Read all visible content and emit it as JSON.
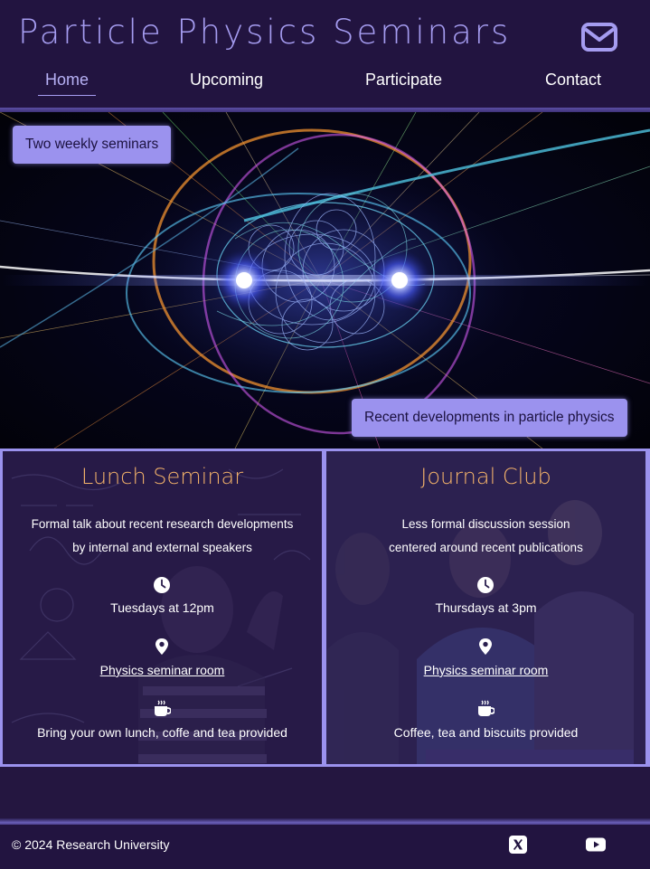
{
  "site": {
    "title": "Particle Physics Seminars"
  },
  "nav": {
    "items": [
      {
        "label": "Home",
        "active": true
      },
      {
        "label": "Upcoming"
      },
      {
        "label": "Participate"
      },
      {
        "label": "Contact"
      }
    ]
  },
  "hero": {
    "tag_left": "Two weekly seminars",
    "tag_right": "Recent developments in particle physics"
  },
  "cards": [
    {
      "title": "Lunch Seminar",
      "desc_line1": "Formal talk about recent research developments",
      "desc_line2": "by internal and external speakers",
      "time": "Tuesdays at 12pm",
      "location": "Physics seminar room",
      "extra": "Bring your own lunch, coffe and tea provided"
    },
    {
      "title": "Journal Club",
      "desc_line1": "Less formal discussion session",
      "desc_line2": "centered around recent publications",
      "time": "Thursdays at 3pm",
      "location": "Physics seminar room",
      "extra": "Coffee, tea and biscuits provided"
    }
  ],
  "footer": {
    "copyright": "© 2024 Research University"
  },
  "icons": {
    "mail": "envelope-icon",
    "clock": "clock-icon",
    "location": "map-pin-icon",
    "coffee": "coffee-cup-icon",
    "x": "x-logo-icon",
    "youtube": "youtube-icon"
  },
  "colors": {
    "background": "#241640",
    "accent": "#a59cf0",
    "tag": "#9b92ee",
    "card_title": "#f4b36a"
  }
}
